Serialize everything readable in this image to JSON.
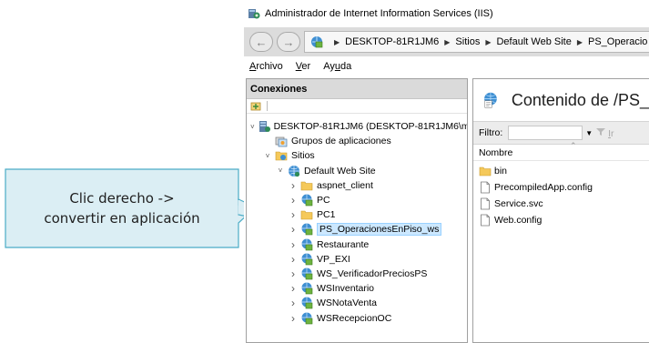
{
  "window": {
    "title": "Administrador de Internet Information Services (IIS)"
  },
  "address": {
    "crumbs": [
      "DESKTOP-81R1JM6",
      "Sitios",
      "Default Web Site",
      "PS_Operacio"
    ]
  },
  "menu": {
    "file_prefix": "A",
    "file_rest": "rchivo",
    "view_prefix": "V",
    "view_rest": "er",
    "help_pre": "Ay",
    "help_u": "u",
    "help_rest": "da"
  },
  "connections": {
    "header": "Conexiones",
    "tree": [
      {
        "label": "DESKTOP-81R1JM6 (DESKTOP-81R1JM6\\m",
        "icon": "server-icon",
        "expander": "open",
        "indent": 0
      },
      {
        "label": "Grupos de aplicaciones",
        "icon": "app-pools-icon",
        "expander": "none",
        "indent": 1
      },
      {
        "label": "Sitios",
        "icon": "sites-folder-icon",
        "expander": "open",
        "indent": 1
      },
      {
        "label": "Default Web Site",
        "icon": "globe-icon",
        "expander": "open",
        "indent": 2
      },
      {
        "label": "aspnet_client",
        "icon": "folder-icon",
        "expander": "closed",
        "indent": 3
      },
      {
        "label": "PC",
        "icon": "web-app-icon",
        "expander": "closed",
        "indent": 3
      },
      {
        "label": "PC1",
        "icon": "folder-icon",
        "expander": "closed",
        "indent": 3
      },
      {
        "label": "PS_OperacionesEnPiso_ws",
        "icon": "web-app-icon",
        "expander": "closed",
        "indent": 3,
        "selected": true
      },
      {
        "label": "Restaurante",
        "icon": "web-app-icon",
        "expander": "closed",
        "indent": 3
      },
      {
        "label": "VP_EXI",
        "icon": "web-app-icon",
        "expander": "closed",
        "indent": 3
      },
      {
        "label": "WS_VerificadorPreciosPS",
        "icon": "web-app-icon",
        "expander": "closed",
        "indent": 3
      },
      {
        "label": "WSInventario",
        "icon": "web-app-icon",
        "expander": "closed",
        "indent": 3
      },
      {
        "label": "WSNotaVenta",
        "icon": "web-app-icon",
        "expander": "closed",
        "indent": 3
      },
      {
        "label": "WSRecepcionOC",
        "icon": "web-app-icon",
        "expander": "closed",
        "indent": 3
      }
    ]
  },
  "content": {
    "title": "Contenido de /PS_",
    "filter_label": "Filtro:",
    "go_prefix": "I",
    "go_rest": "r",
    "column_name": "Nombre",
    "files": [
      {
        "name": "bin",
        "icon": "folder-icon"
      },
      {
        "name": "PrecompiledApp.config",
        "icon": "file-icon"
      },
      {
        "name": "Service.svc",
        "icon": "file-icon"
      },
      {
        "name": "Web.config",
        "icon": "file-icon"
      }
    ]
  },
  "callout": {
    "line1": "Clic derecho ->",
    "line2": "convertir en aplicación"
  },
  "colors": {
    "callout_fill": "#dbeef4",
    "callout_border": "#4bacc6",
    "selection": "#cce8ff",
    "folder": "#f5c95a"
  }
}
